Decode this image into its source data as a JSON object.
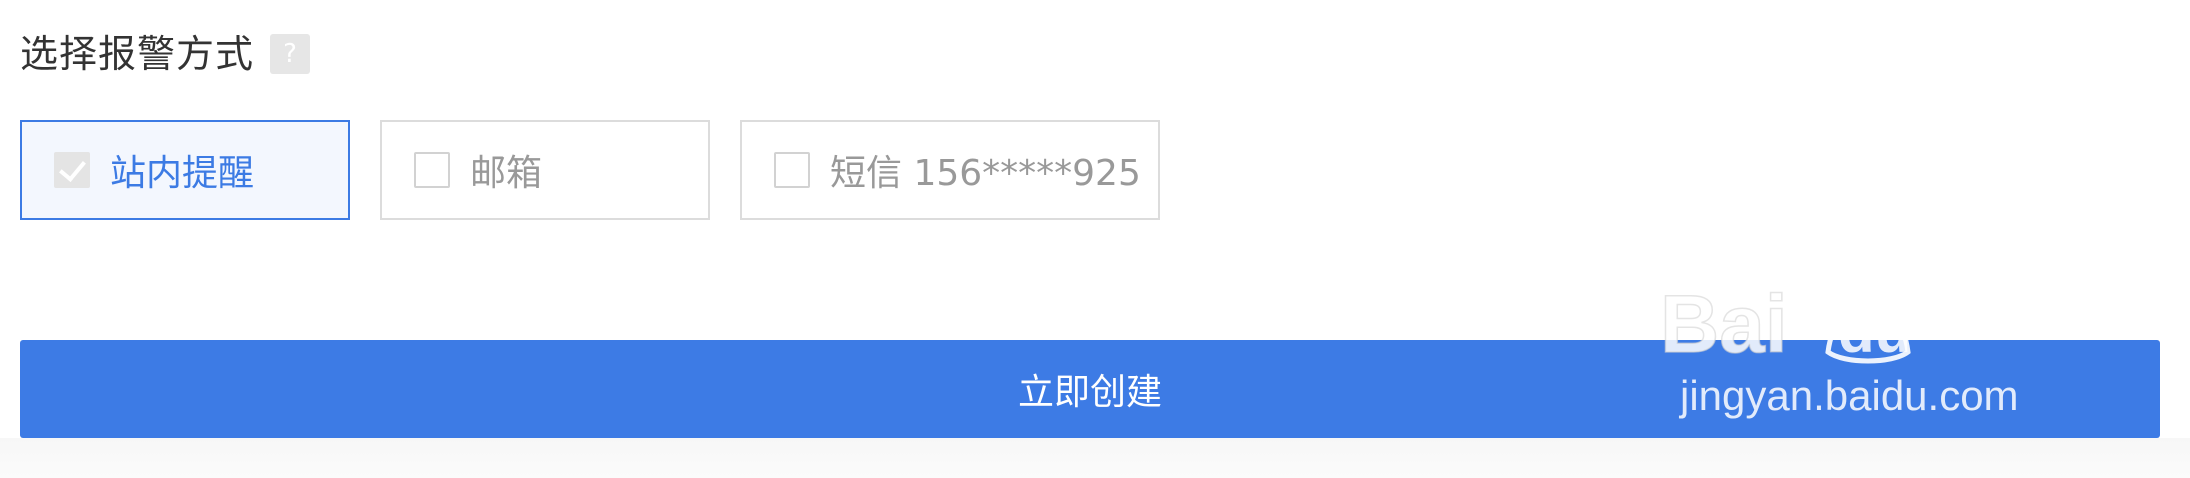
{
  "section": {
    "title": "选择报警方式",
    "help_glyph": "?"
  },
  "alert_options": [
    {
      "label": "站内提醒",
      "checked": true
    },
    {
      "label": "邮箱",
      "checked": false
    },
    {
      "label": "短信 156*****925",
      "checked": false
    }
  ],
  "actions": {
    "create_label": "立即创建"
  },
  "watermark": {
    "text": "jingyan.baidu.com"
  },
  "colors": {
    "accent": "#3d7be5",
    "selected_bg": "#f3f7fe",
    "border": "#dcdcdc",
    "muted_text": "#999999"
  }
}
